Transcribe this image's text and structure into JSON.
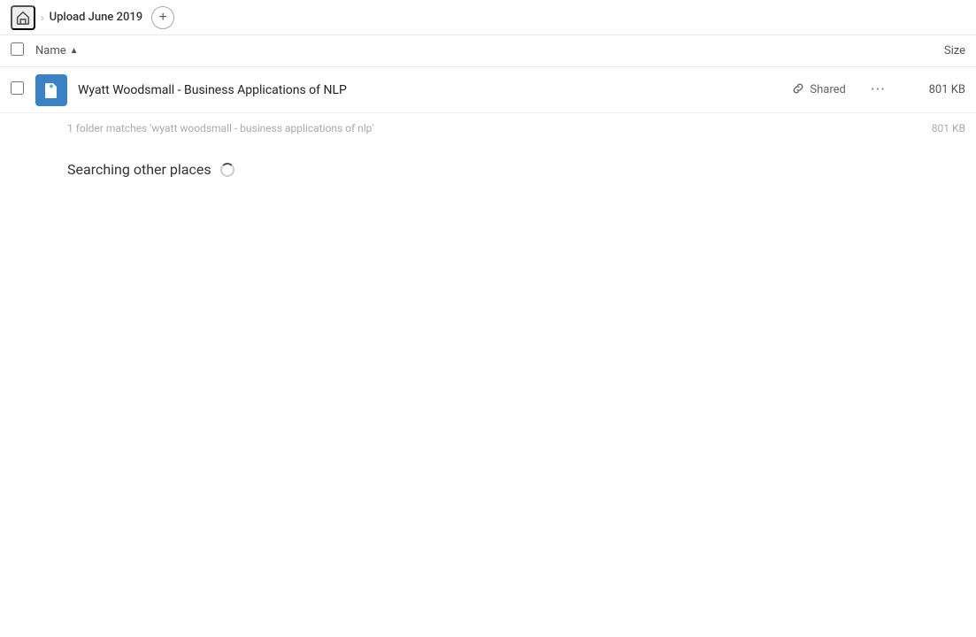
{
  "header": {
    "home_label": "Home",
    "breadcrumb_label": "Upload June 2019",
    "add_button_label": "+"
  },
  "columns": {
    "name_label": "Name",
    "size_label": "Size"
  },
  "file_row": {
    "name": "Wyatt Woodsmall - Business Applications of NLP",
    "shared_label": "Shared",
    "size": "801 KB"
  },
  "folder_matches": {
    "text": "1 folder matches 'wyatt woodsmall - business applications of nlp'",
    "size": "801 KB"
  },
  "searching": {
    "label": "Searching other places"
  },
  "icons": {
    "home": "⌂",
    "chevron_right": "›",
    "sort_up": "▲",
    "link": "🔗",
    "more": "···"
  },
  "colors": {
    "file_icon_bg": "#3b82c4",
    "accent": "#3b82c4"
  }
}
